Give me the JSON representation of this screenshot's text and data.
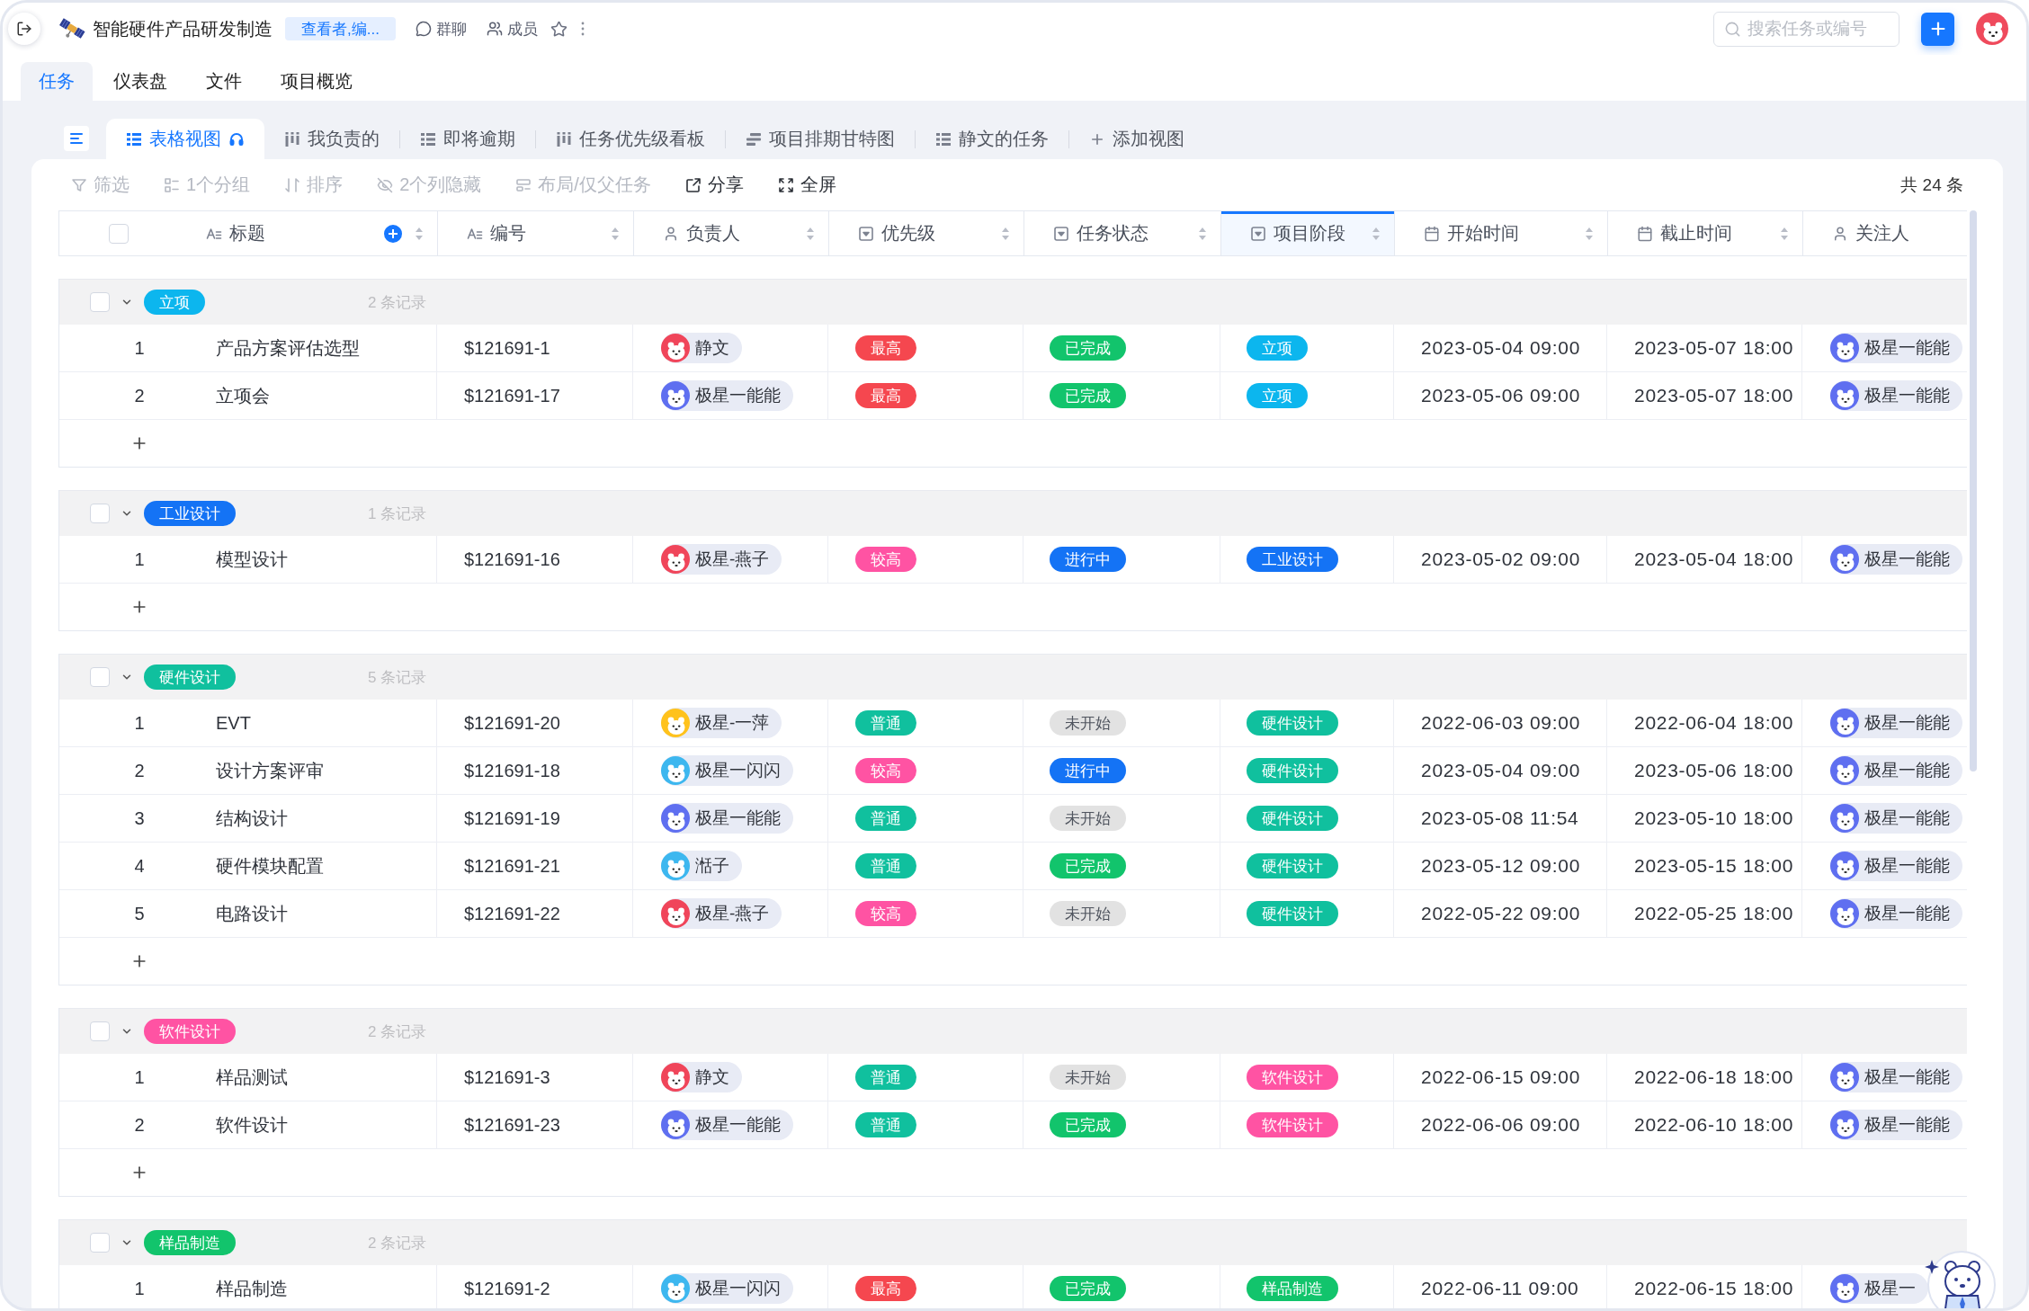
{
  "header": {
    "title": "智能硬件产品研发制造",
    "role": "查看者,编...",
    "links": [
      {
        "kind": "chat",
        "label": "群聊"
      },
      {
        "kind": "members",
        "label": "成员"
      }
    ],
    "search": {
      "placeholder": "搜索任务或编号"
    }
  },
  "tabs": [
    {
      "label": "任务",
      "selected": true
    },
    {
      "label": "仪表盘",
      "selected": false
    },
    {
      "label": "文件",
      "selected": false
    },
    {
      "label": "项目概览",
      "selected": false
    }
  ],
  "views": {
    "items": [
      {
        "kind": "list",
        "label": "表格视图",
        "selected": true
      },
      {
        "kind": "board",
        "label": "我负责的",
        "selected": false
      },
      {
        "kind": "list",
        "label": "即将逾期",
        "selected": false
      },
      {
        "kind": "board",
        "label": "任务优先级看板",
        "selected": false
      },
      {
        "kind": "gantt",
        "label": "项目排期甘特图",
        "selected": false
      },
      {
        "kind": "list",
        "label": "静文的任务",
        "selected": false
      }
    ],
    "add_label": "添加视图"
  },
  "toolbar": {
    "actions": [
      {
        "kind": "filter",
        "label": "筛选",
        "disabled": true
      },
      {
        "kind": "group",
        "label": "1个分组",
        "disabled": true
      },
      {
        "kind": "sort",
        "label": "排序",
        "disabled": true
      },
      {
        "kind": "hide",
        "label": "2个列隐藏",
        "disabled": true
      },
      {
        "kind": "layout",
        "label": "布局/仅父任务",
        "disabled": true
      },
      {
        "kind": "share",
        "label": "分享",
        "disabled": false
      },
      {
        "kind": "fullscreen",
        "label": "全屏",
        "disabled": false
      }
    ],
    "total": "共 24 条"
  },
  "table": {
    "select_all": {
      "checked": false
    },
    "columns": [
      {
        "kind": "title",
        "label": "标题",
        "selected": false,
        "sortable": true
      },
      {
        "kind": "text",
        "label": "编号",
        "selected": false,
        "sortable": true
      },
      {
        "kind": "person",
        "label": "负责人",
        "selected": false,
        "sortable": true
      },
      {
        "kind": "select",
        "label": "优先级",
        "selected": false,
        "sortable": true
      },
      {
        "kind": "select",
        "label": "任务状态",
        "selected": false,
        "sortable": true
      },
      {
        "kind": "select",
        "label": "项目阶段",
        "selected": true,
        "sortable": true
      },
      {
        "kind": "date",
        "label": "开始时间",
        "selected": false,
        "sortable": true
      },
      {
        "kind": "date",
        "label": "截止时间",
        "selected": false,
        "sortable": true
      },
      {
        "kind": "person",
        "label": "关注人",
        "selected": false,
        "sortable": false
      }
    ],
    "groups": [
      {
        "tag": {
          "label": "立项",
          "color": "#0cb6ee"
        },
        "count": "2 条记录",
        "checked": false,
        "expanded": true,
        "rows": [
          {
            "index": "1",
            "title": "产品方案评估选型",
            "code": "$121691-1",
            "assignee": {
              "name": "静文",
              "color": "#f0455a"
            },
            "priority": {
              "label": "最高",
              "color": "#f5474f"
            },
            "status": {
              "label": "已完成",
              "color": "#12c46c"
            },
            "stage": {
              "label": "立项",
              "color": "#0cb6ee"
            },
            "start": "2023-05-04 09:00",
            "due": "2023-05-07 18:00",
            "follower": {
              "name": "极星一能能",
              "color": "#5f6ff0"
            }
          },
          {
            "index": "2",
            "title": "立项会",
            "code": "$121691-17",
            "assignee": {
              "name": "极星一能能",
              "color": "#5f6ff0"
            },
            "priority": {
              "label": "最高",
              "color": "#f5474f"
            },
            "status": {
              "label": "已完成",
              "color": "#12c46c"
            },
            "stage": {
              "label": "立项",
              "color": "#0cb6ee"
            },
            "start": "2023-05-06 09:00",
            "due": "2023-05-07 18:00",
            "follower": {
              "name": "极星一能能",
              "color": "#5f6ff0"
            }
          }
        ]
      },
      {
        "tag": {
          "label": "工业设计",
          "color": "#1473f5"
        },
        "count": "1 条记录",
        "checked": false,
        "expanded": true,
        "rows": [
          {
            "index": "1",
            "title": "模型设计",
            "code": "$121691-16",
            "assignee": {
              "name": "极星-燕子",
              "color": "#f0455a"
            },
            "priority": {
              "label": "较高",
              "color": "#ff53a3"
            },
            "status": {
              "label": "进行中",
              "color": "#1473f5"
            },
            "stage": {
              "label": "工业设计",
              "color": "#1473f5"
            },
            "start": "2023-05-02 09:00",
            "due": "2023-05-04 18:00",
            "follower": {
              "name": "极星一能能",
              "color": "#5f6ff0"
            }
          }
        ]
      },
      {
        "tag": {
          "label": "硬件设计",
          "color": "#10c09e"
        },
        "count": "5 条记录",
        "checked": false,
        "expanded": true,
        "rows": [
          {
            "index": "1",
            "title": "EVT",
            "code": "$121691-20",
            "assignee": {
              "name": "极星-一萍",
              "color": "#ffc21c"
            },
            "priority": {
              "label": "普通",
              "color": "#10c09e"
            },
            "status": {
              "label": "未开始",
              "color": "#e2e2e2"
            },
            "stage": {
              "label": "硬件设计",
              "color": "#10c09e"
            },
            "start": "2022-06-03 09:00",
            "due": "2022-06-04 18:00",
            "follower": {
              "name": "极星一能能",
              "color": "#5f6ff0"
            }
          },
          {
            "index": "2",
            "title": "设计方案评审",
            "code": "$121691-18",
            "assignee": {
              "name": "极星一闪闪",
              "color": "#3db7ef"
            },
            "priority": {
              "label": "较高",
              "color": "#ff53a3"
            },
            "status": {
              "label": "进行中",
              "color": "#1473f5"
            },
            "stage": {
              "label": "硬件设计",
              "color": "#10c09e"
            },
            "start": "2023-05-04 09:00",
            "due": "2023-05-06 18:00",
            "follower": {
              "name": "极星一能能",
              "color": "#5f6ff0"
            }
          },
          {
            "index": "3",
            "title": "结构设计",
            "code": "$121691-19",
            "assignee": {
              "name": "极星一能能",
              "color": "#5f6ff0"
            },
            "priority": {
              "label": "普通",
              "color": "#10c09e"
            },
            "status": {
              "label": "未开始",
              "color": "#e2e2e2"
            },
            "stage": {
              "label": "硬件设计",
              "color": "#10c09e"
            },
            "start": "2023-05-08 11:54",
            "due": "2023-05-10 18:00",
            "follower": {
              "name": "极星一能能",
              "color": "#5f6ff0"
            }
          },
          {
            "index": "4",
            "title": "硬件模块配置",
            "code": "$121691-21",
            "assignee": {
              "name": "湉子",
              "color": "#3db7ef"
            },
            "priority": {
              "label": "普通",
              "color": "#10c09e"
            },
            "status": {
              "label": "已完成",
              "color": "#12c46c"
            },
            "stage": {
              "label": "硬件设计",
              "color": "#10c09e"
            },
            "start": "2023-05-12 09:00",
            "due": "2023-05-15 18:00",
            "follower": {
              "name": "极星一能能",
              "color": "#5f6ff0"
            }
          },
          {
            "index": "5",
            "title": "电路设计",
            "code": "$121691-22",
            "assignee": {
              "name": "极星-燕子",
              "color": "#f0455a"
            },
            "priority": {
              "label": "较高",
              "color": "#ff53a3"
            },
            "status": {
              "label": "未开始",
              "color": "#e2e2e2"
            },
            "stage": {
              "label": "硬件设计",
              "color": "#10c09e"
            },
            "start": "2022-05-22 09:00",
            "due": "2022-05-25 18:00",
            "follower": {
              "name": "极星一能能",
              "color": "#5f6ff0"
            }
          }
        ]
      },
      {
        "tag": {
          "label": "软件设计",
          "color": "#ff53a3"
        },
        "count": "2 条记录",
        "checked": false,
        "expanded": true,
        "rows": [
          {
            "index": "1",
            "title": "样品测试",
            "code": "$121691-3",
            "assignee": {
              "name": "静文",
              "color": "#f0455a"
            },
            "priority": {
              "label": "普通",
              "color": "#10c09e"
            },
            "status": {
              "label": "未开始",
              "color": "#e2e2e2"
            },
            "stage": {
              "label": "软件设计",
              "color": "#ff53a3"
            },
            "start": "2022-06-15 09:00",
            "due": "2022-06-18 18:00",
            "follower": {
              "name": "极星一能能",
              "color": "#5f6ff0"
            }
          },
          {
            "index": "2",
            "title": "软件设计",
            "code": "$121691-23",
            "assignee": {
              "name": "极星一能能",
              "color": "#5f6ff0"
            },
            "priority": {
              "label": "普通",
              "color": "#10c09e"
            },
            "status": {
              "label": "已完成",
              "color": "#12c46c"
            },
            "stage": {
              "label": "软件设计",
              "color": "#ff53a3"
            },
            "start": "2022-06-06 09:00",
            "due": "2022-06-10 18:00",
            "follower": {
              "name": "极星一能能",
              "color": "#5f6ff0"
            }
          }
        ]
      },
      {
        "tag": {
          "label": "样品制造",
          "color": "#12c46c"
        },
        "count": "2 条记录",
        "checked": false,
        "expanded": true,
        "rows": [
          {
            "index": "1",
            "title": "样品制造",
            "code": "$121691-2",
            "assignee": {
              "name": "极星一闪闪",
              "color": "#3db7ef"
            },
            "priority": {
              "label": "最高",
              "color": "#f5474f"
            },
            "status": {
              "label": "已完成",
              "color": "#12c46c"
            },
            "stage": {
              "label": "样品制造",
              "color": "#12c46c"
            },
            "start": "2022-06-11 09:00",
            "due": "2022-06-15 18:00",
            "follower": {
              "name": "极星一",
              "color": "#5f6ff0"
            }
          }
        ]
      }
    ]
  }
}
